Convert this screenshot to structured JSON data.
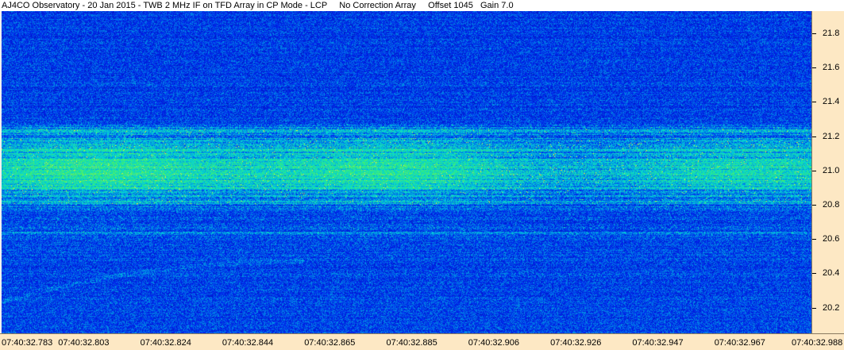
{
  "title": "AJ4CO Observatory - 20 Jan 2015 - TWB 2 MHz IF on TFD Array in CP Mode - LCP     No Correction Array     Offset 1045   Gain 7.0",
  "colors": {
    "background_low": "#0b1f8c",
    "background_mid": "#2850d0",
    "band_high": "#3fd6c0",
    "band_peak": "#c8f070",
    "axis_bg": "#fde8c4"
  },
  "chart_data": {
    "type": "heatmap",
    "title": "AJ4CO Observatory - 20 Jan 2015 - TWB 2 MHz IF on TFD Array in CP Mode - LCP     No Correction Array     Offset 1045   Gain 7.0",
    "xlabel": "",
    "ylabel": "",
    "x_ticks": [
      "07:40:32.783",
      "07:40:32.803",
      "07:40:32.824",
      "07:40:32.844",
      "07:40:32.865",
      "07:40:32.885",
      "07:40:32.906",
      "07:40:32.926",
      "07:40:32.947",
      "07:40:32.967",
      "07:40:32.988"
    ],
    "y_ticks": [
      21.8,
      21.6,
      21.4,
      21.2,
      21.0,
      20.8,
      20.6,
      20.4,
      20.2
    ],
    "ylim": [
      20.05,
      21.93
    ],
    "y_unit_hint": "MHz",
    "grid": false,
    "colormap": "jet",
    "emission_bands_mhz": [
      {
        "center": 21.24,
        "width": 0.02,
        "strength": 0.5
      },
      {
        "center": 21.18,
        "width": 0.03,
        "strength": 0.45
      },
      {
        "center": 21.1,
        "width": 0.05,
        "strength": 0.75
      },
      {
        "center": 21.03,
        "width": 0.04,
        "strength": 0.7
      },
      {
        "center": 20.96,
        "width": 0.04,
        "strength": 0.85
      },
      {
        "center": 20.9,
        "width": 0.03,
        "strength": 0.6
      },
      {
        "center": 20.82,
        "width": 0.03,
        "strength": 0.55
      },
      {
        "center": 20.67,
        "width": 0.04,
        "strength": 0.25
      }
    ]
  }
}
